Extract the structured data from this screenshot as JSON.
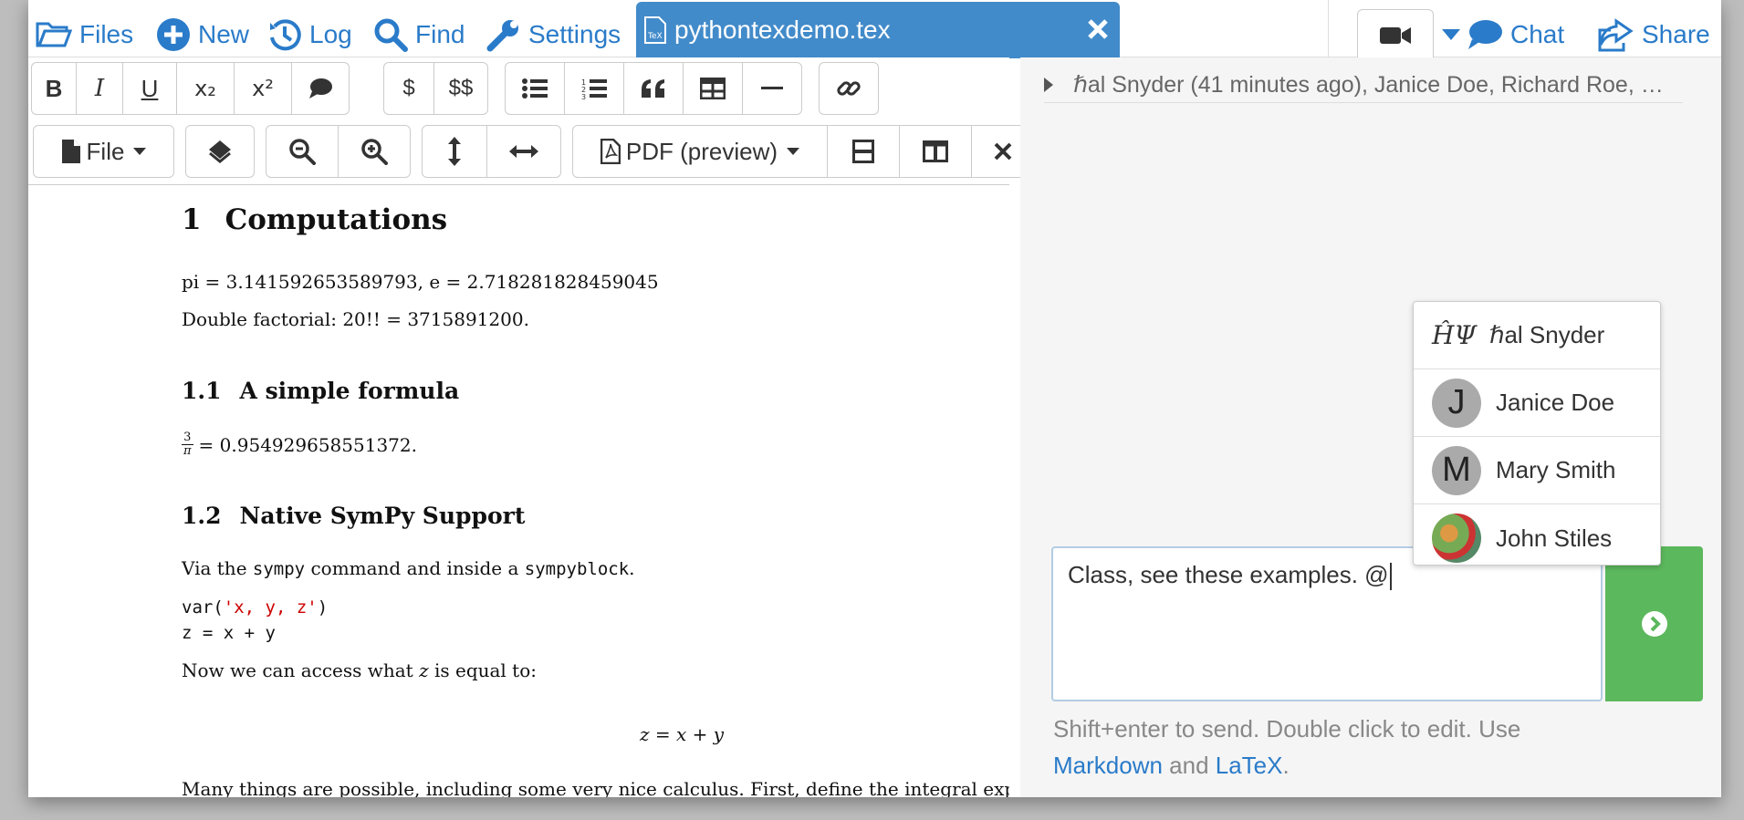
{
  "topbar": {
    "files": "Files",
    "new": "New",
    "log": "Log",
    "find": "Find",
    "settings": "Settings",
    "file_tab": "pythontexdemo.tex",
    "chat": "Chat",
    "share": "Share"
  },
  "format_toolbar": {
    "bold": "B",
    "italic": "I",
    "underline": "U",
    "subscript": "x₂",
    "superscript": "x²",
    "inline_math": "$",
    "display_math": "$$"
  },
  "control_toolbar": {
    "file": "File",
    "pdf": "PDF (preview)"
  },
  "document": {
    "sec1_num": "1",
    "sec1_title": "Computations",
    "line1": "pi = 3.141592653589793, e = 2.718281828459045",
    "line2": "Double factorial:  20!! = 3715891200.",
    "sec11_num": "1.1",
    "sec11_title": "A simple formula",
    "frac_num": "3",
    "frac_den": "π",
    "formula_result": "= 0.954929658551372.",
    "sec12_num": "1.2",
    "sec12_title": "Native SymPy Support",
    "via_pre": "Via the ",
    "via_cmd": "sympy",
    "via_mid": " command and inside a ",
    "via_block": "sympyblock",
    "via_post": ".",
    "code1_pre": "var(",
    "code1_str": "'x, y, z'",
    "code1_post": ")",
    "code2": "z = x + y",
    "access_pre": "Now we can access what ",
    "access_var": "z",
    "access_post": " is equal to:",
    "display_eq": "z = x + y",
    "many": "Many things are possible, including some very nice calculus.  First, define the integral exp"
  },
  "chat": {
    "history": "ℏal Snyder (41 minutes ago), Janice Doe, Richard Roe, …",
    "input_value": "Class, see these examples. @",
    "help_line1": "Shift+enter to send. Double click to edit. Use",
    "help_link1": "Markdown",
    "help_and": " and ",
    "help_link2": "LaTeX",
    "help_end": "."
  },
  "mentions": [
    {
      "mark": "ĤΨ",
      "name": "ℏal Snyder"
    },
    {
      "initial": "J",
      "name": "Janice Doe"
    },
    {
      "initial": "M",
      "name": "Mary Smith"
    },
    {
      "name": "John Stiles"
    }
  ],
  "colors": {
    "accent": "#2a7bc9",
    "tab": "#428bca",
    "send": "#5cb85c"
  }
}
